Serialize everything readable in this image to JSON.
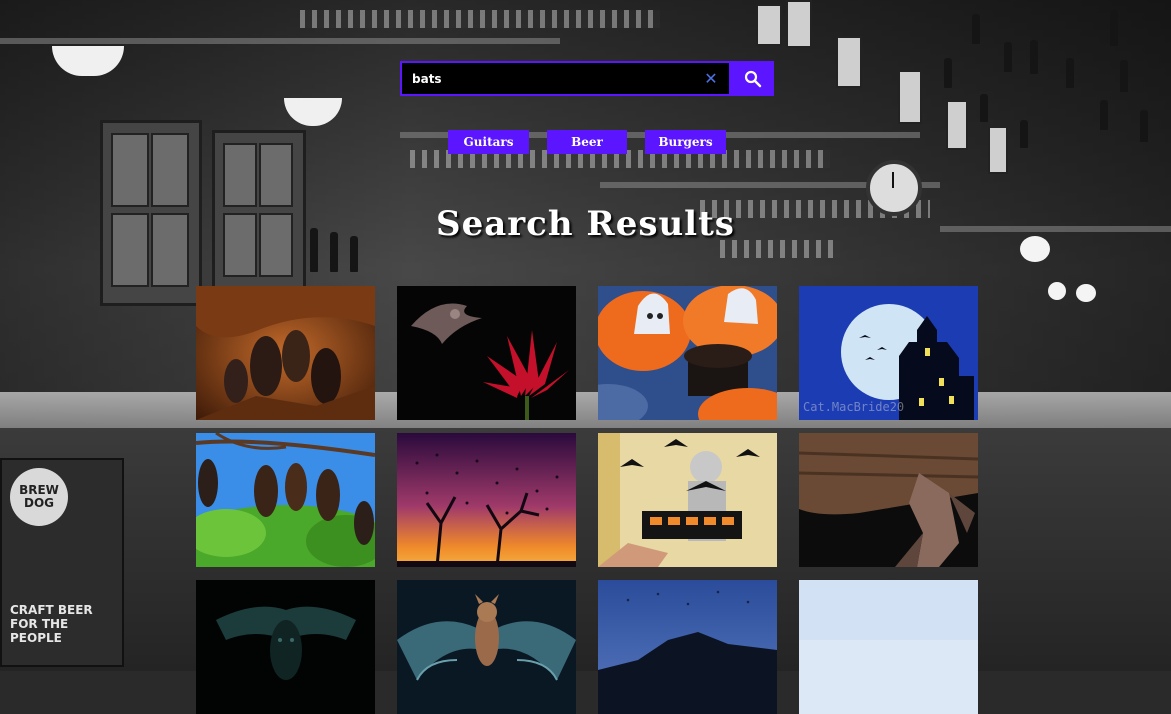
{
  "search": {
    "value": "bats",
    "placeholder": "",
    "clear_icon": "close-icon",
    "submit_icon": "search-icon"
  },
  "tags": [
    {
      "label": "Guitars"
    },
    {
      "label": "Beer"
    },
    {
      "label": "Burgers"
    }
  ],
  "heading": "Search Results",
  "results": [
    {
      "subject": "bats hanging in cave"
    },
    {
      "subject": "bat flying near red flower"
    },
    {
      "subject": "orange cupcakes with ghosts"
    },
    {
      "subject": "haunted house with moon and bats",
      "watermark": "Cat.MacBride20"
    },
    {
      "subject": "fruit bats hanging in tree"
    },
    {
      "subject": "bats swarming at sunset"
    },
    {
      "subject": "child with bat crafts"
    },
    {
      "subject": "bat on wooden log"
    },
    {
      "subject": "bat in dark cave"
    },
    {
      "subject": "bat with spread wings"
    },
    {
      "subject": "bats at dusk over landscape"
    },
    {
      "subject": "pale sky"
    }
  ],
  "background": {
    "poster_logo": "BREW DOG",
    "poster_text": "CRAFT BEER FOR THE PEOPLE"
  },
  "colors": {
    "accent": "#5c16ff",
    "clear_icon": "#4a73e8",
    "heading": "#ffffff"
  }
}
